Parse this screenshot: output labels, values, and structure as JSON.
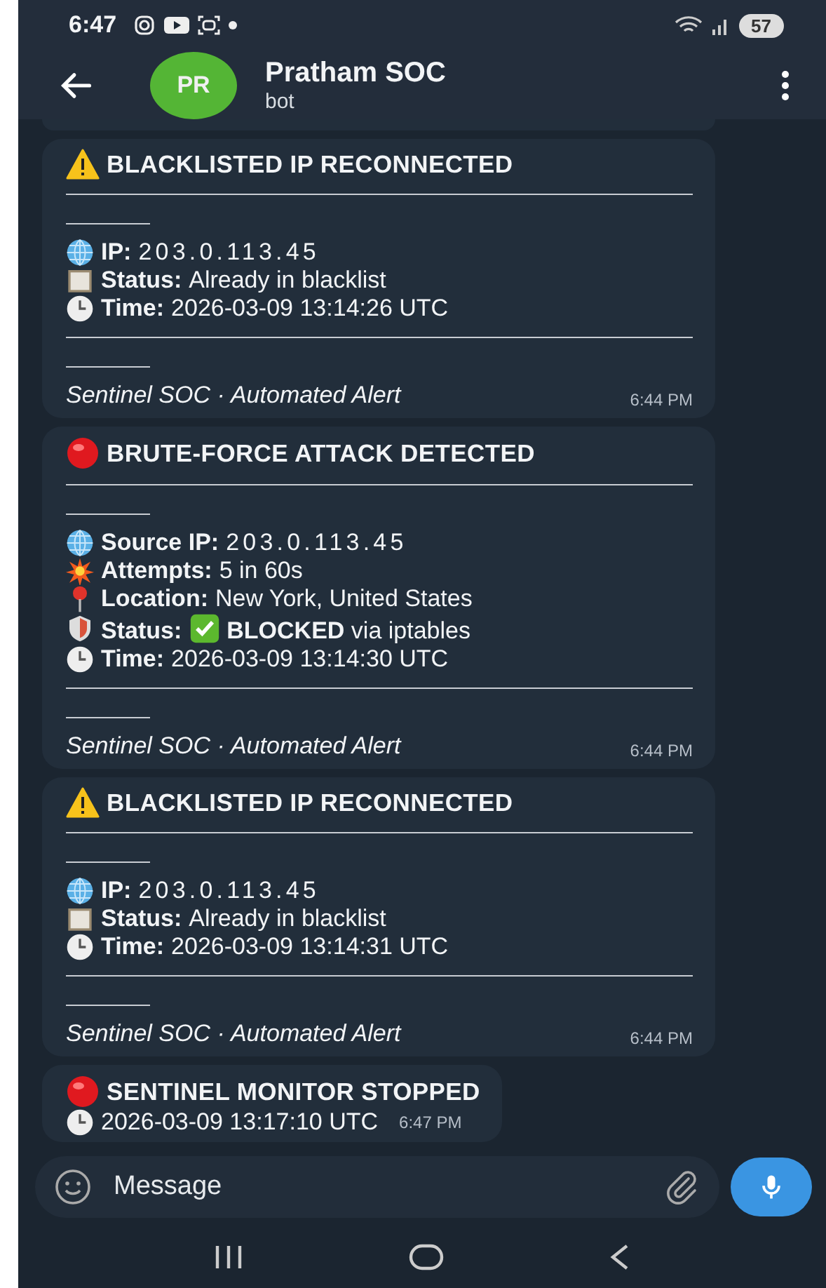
{
  "status_bar": {
    "time": "6:47",
    "battery": "57"
  },
  "header": {
    "avatar": "PR",
    "title": "Pratham SOC",
    "subtitle": "bot"
  },
  "messages": [
    {
      "kind": "blacklist",
      "title": "BLACKLISTED IP RECONNECTED",
      "fields": [
        {
          "kind": "ip",
          "label": "IP:",
          "value": "203.0.113.45"
        },
        {
          "kind": "status",
          "label": "Status:",
          "value": "Already in blacklist"
        },
        {
          "kind": "time",
          "label": "Time:",
          "value": "2026-03-09 13:14:26 UTC"
        }
      ],
      "footer": "Sentinel SOC · Automated Alert",
      "time": "6:44 PM"
    },
    {
      "kind": "attack",
      "title": "BRUTE-FORCE ATTACK DETECTED",
      "fields": [
        {
          "kind": "ip",
          "label": "Source IP:",
          "value": "203.0.113.45"
        },
        {
          "kind": "attempts",
          "label": "Attempts:",
          "value": "5 in 60s"
        },
        {
          "kind": "location",
          "label": "Location:",
          "value": "New York, United States"
        },
        {
          "kind": "blocked",
          "label": "Status:",
          "value": "**BLOCKED** via iptables"
        },
        {
          "kind": "time",
          "label": "Time:",
          "value": "2026-03-09 13:14:30 UTC"
        }
      ],
      "footer": "Sentinel SOC · Automated Alert",
      "time": "6:44 PM"
    },
    {
      "kind": "blacklist",
      "title": "BLACKLISTED IP RECONNECTED",
      "fields": [
        {
          "kind": "ip",
          "label": "IP:",
          "value": "203.0.113.45"
        },
        {
          "kind": "status",
          "label": "Status:",
          "value": "Already in blacklist"
        },
        {
          "kind": "time",
          "label": "Time:",
          "value": "2026-03-09 13:14:31 UTC"
        }
      ],
      "footer": "Sentinel SOC · Automated Alert",
      "time": "6:44 PM"
    },
    {
      "kind": "stopped",
      "title": "SENTINEL MONITOR STOPPED",
      "fields": [
        {
          "kind": "time",
          "value": "2026-03-09 13:17:10 UTC"
        }
      ],
      "time": "6:47 PM"
    }
  ],
  "composer": {
    "placeholder": "Message"
  }
}
